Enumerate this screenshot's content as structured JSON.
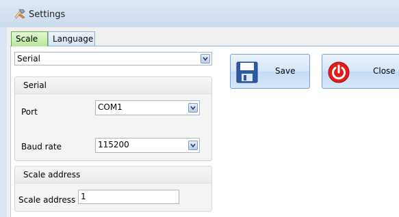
{
  "window": {
    "title": "Settings"
  },
  "tabs": [
    {
      "label": "Scale",
      "active": true
    },
    {
      "label": "Language",
      "active": false
    }
  ],
  "connection_type": {
    "value": "Serial"
  },
  "serial_group": {
    "title": "Serial",
    "port": {
      "label": "Port",
      "value": "COM1"
    },
    "baud_rate": {
      "label": "Baud rate",
      "value": "115200"
    }
  },
  "scale_address_group": {
    "title": "Scale address",
    "field": {
      "label": "Scale address",
      "value": "1"
    }
  },
  "buttons": {
    "save": {
      "label": "Save",
      "icon": "floppy-disk-icon"
    },
    "close": {
      "label": "Close",
      "icon": "power-icon"
    }
  },
  "colors": {
    "close_icon_red": "#e51b1b",
    "save_icon_blue": "#2d5aa6",
    "active_tab_green": "#b6e79a"
  }
}
